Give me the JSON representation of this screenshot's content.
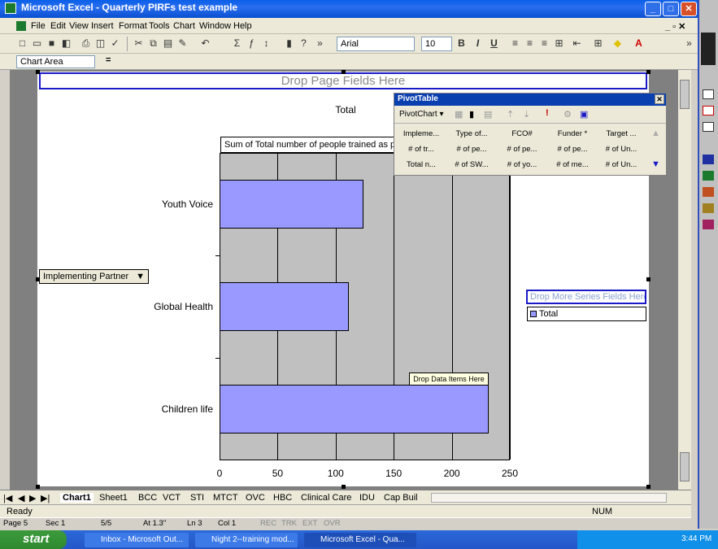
{
  "window": {
    "title": "Microsoft Excel - Quarterly PIRFs test example"
  },
  "menu": [
    "File",
    "Edit",
    "View",
    "Insert",
    "Format",
    "Tools",
    "Chart",
    "Window",
    "Help"
  ],
  "toolbar": {
    "font": "Arial",
    "font_size": "10",
    "bold": "B",
    "italic": "I",
    "underline": "U"
  },
  "namebox": {
    "value": "Chart Area",
    "equals": "="
  },
  "chart": {
    "drop_page": "Drop Page Fields Here",
    "total_label": "Total",
    "data_field": "Sum of Total number of people trained as pe",
    "row_field": "Implementing Partner",
    "drop_series": "Drop More Series Fields Here",
    "legend_item": "Total",
    "drop_data": "Drop Data Items Here"
  },
  "chart_data": {
    "type": "bar",
    "orientation": "horizontal",
    "categories": [
      "Youth Voice",
      "Global Health",
      "Children life"
    ],
    "values": [
      124,
      111,
      232
    ],
    "series": [
      {
        "name": "Total",
        "values": [
          124,
          111,
          232
        ]
      }
    ],
    "xlim": [
      0,
      250
    ],
    "xticks": [
      "0",
      "50",
      "100",
      "150",
      "200",
      "250"
    ],
    "legend": "right",
    "grid": true
  },
  "pivot": {
    "title": "PivotTable",
    "menu_label": "PivotChart ▾",
    "fields_row1": [
      "Impleme...",
      "Type of...",
      "FCO#",
      "Funder *",
      "Target ..."
    ],
    "fields_row2": [
      "# of tr...",
      "# of pe...",
      "# of pe...",
      "# of pe...",
      "# of Un..."
    ],
    "fields_row3": [
      "Total n...",
      "# of SW...",
      "# of yo...",
      "# of me...",
      "# of Un..."
    ]
  },
  "sheets": [
    "Chart1",
    "Sheet1",
    "BCC",
    "VCT",
    "STI",
    "MTCT",
    "OVC",
    "HBC",
    "Clinical Care",
    "IDU",
    "Cap Buil"
  ],
  "status": {
    "ready": "Ready",
    "num": "NUM",
    "page": "Page 5",
    "sec": "Sec 1",
    "pages": "5/5",
    "at": "At 1.3\"",
    "ln": "Ln 3",
    "col": "Col 1",
    "rec": "REC",
    "trk": "TRK",
    "ext": "EXT",
    "ovr": "OVR"
  },
  "taskbar": {
    "start": "start",
    "items": [
      "Inbox - Microsoft Out...",
      "Night 2--training mod...",
      "Microsoft Excel - Qua..."
    ],
    "clock": "3:44 PM"
  }
}
